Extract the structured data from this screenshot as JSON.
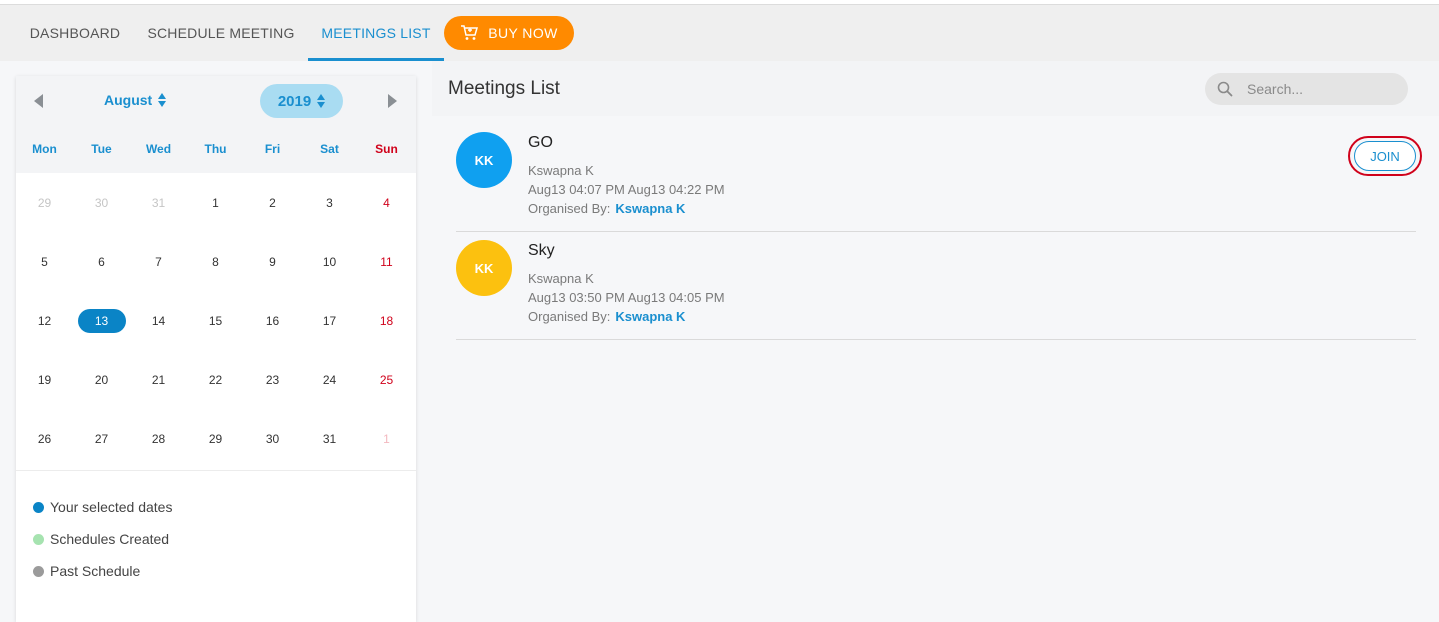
{
  "nav": {
    "tabs": [
      {
        "label": "DASHBOARD"
      },
      {
        "label": "SCHEDULE MEETING"
      },
      {
        "label": "MEETINGS LIST"
      }
    ],
    "active_tab": "MEETINGS LIST",
    "buy_label": "BUY NOW"
  },
  "calendar": {
    "month": "August",
    "year": "2019",
    "weekdays": [
      "Mon",
      "Tue",
      "Wed",
      "Thu",
      "Fri",
      "Sat",
      "Sun"
    ],
    "weeks": [
      [
        "29",
        "30",
        "31",
        "1",
        "2",
        "3",
        "4"
      ],
      [
        "5",
        "6",
        "7",
        "8",
        "9",
        "10",
        "11"
      ],
      [
        "12",
        "13",
        "14",
        "15",
        "16",
        "17",
        "18"
      ],
      [
        "19",
        "20",
        "21",
        "22",
        "23",
        "24",
        "25"
      ],
      [
        "26",
        "27",
        "28",
        "29",
        "30",
        "31",
        "1"
      ]
    ],
    "selected_day": "13",
    "legend": [
      {
        "label": "Your selected dates",
        "color": "#0a84c6"
      },
      {
        "label": "Schedules Created",
        "color": "#a6e3b0"
      },
      {
        "label": "Past Schedule",
        "color": "#9b9b9b"
      }
    ]
  },
  "meetings_panel": {
    "title": "Meetings List",
    "search_placeholder": "Search...",
    "organised_by_label": "Organised By:",
    "join_label": "JOIN"
  },
  "meetings": [
    {
      "initials": "KK",
      "avatar_color": "#0fa0f0",
      "title": "GO",
      "host": "Kswapna K",
      "time": "Aug13 04:07 PM Aug13 04:22 PM",
      "organiser": "Kswapna K"
    },
    {
      "initials": "KK",
      "avatar_color": "#fcc10f",
      "title": "Sky",
      "host": "Kswapna K",
      "time": "Aug13 03:50 PM Aug13 04:05 PM",
      "organiser": "Kswapna K"
    }
  ],
  "colors": {
    "accent": "#1a8fcf",
    "buy": "#ff8a00",
    "weekend": "#d0021b",
    "join_highlight": "#d0021b"
  }
}
